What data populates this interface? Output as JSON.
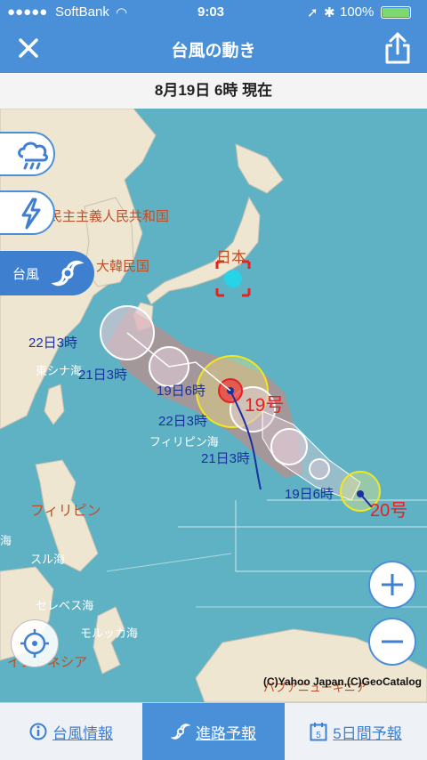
{
  "status": {
    "carrier": "SoftBank",
    "time": "9:03",
    "battery": "100%"
  },
  "header": {
    "title": "台風の動き"
  },
  "datebar": {
    "text": "8月19日 6時 現在"
  },
  "side_buttons": {
    "typhoon_label": "台風"
  },
  "map": {
    "country_labels": [
      "民主主義人民共和国",
      "大韓民国",
      "日本",
      "フィリピン",
      "パプアニューギニア",
      "インドネシア"
    ],
    "sea_labels": [
      "東シナ海",
      "フィリピン海",
      "スル海",
      "セレベス海",
      "モルッカ海",
      "海"
    ],
    "typhoon_19": {
      "name": "19号",
      "time_labels": [
        "19日6時",
        "21日3時",
        "22日3時"
      ],
      "track_extra_labels": [
        "21日3時",
        "22日3時"
      ]
    },
    "typhoon_20": {
      "name": "20号",
      "time_labels": [
        "19日6時"
      ]
    },
    "copyright": "(C)Yahoo Japan,(C)GeoCatalog"
  },
  "tabs": [
    {
      "label": "台風情報",
      "icon": "info-icon",
      "active": false
    },
    {
      "label": "進路予報",
      "icon": "typhoon-icon",
      "active": true
    },
    {
      "label": "5日間予報",
      "icon": "calendar-icon",
      "active": false
    }
  ],
  "calendar_icon_number": "5",
  "colors": {
    "primary": "#4a90d9",
    "tab_active": "#4a90d9",
    "typhoon_red": "#e82020",
    "track_blue": "#1a2fa0"
  }
}
